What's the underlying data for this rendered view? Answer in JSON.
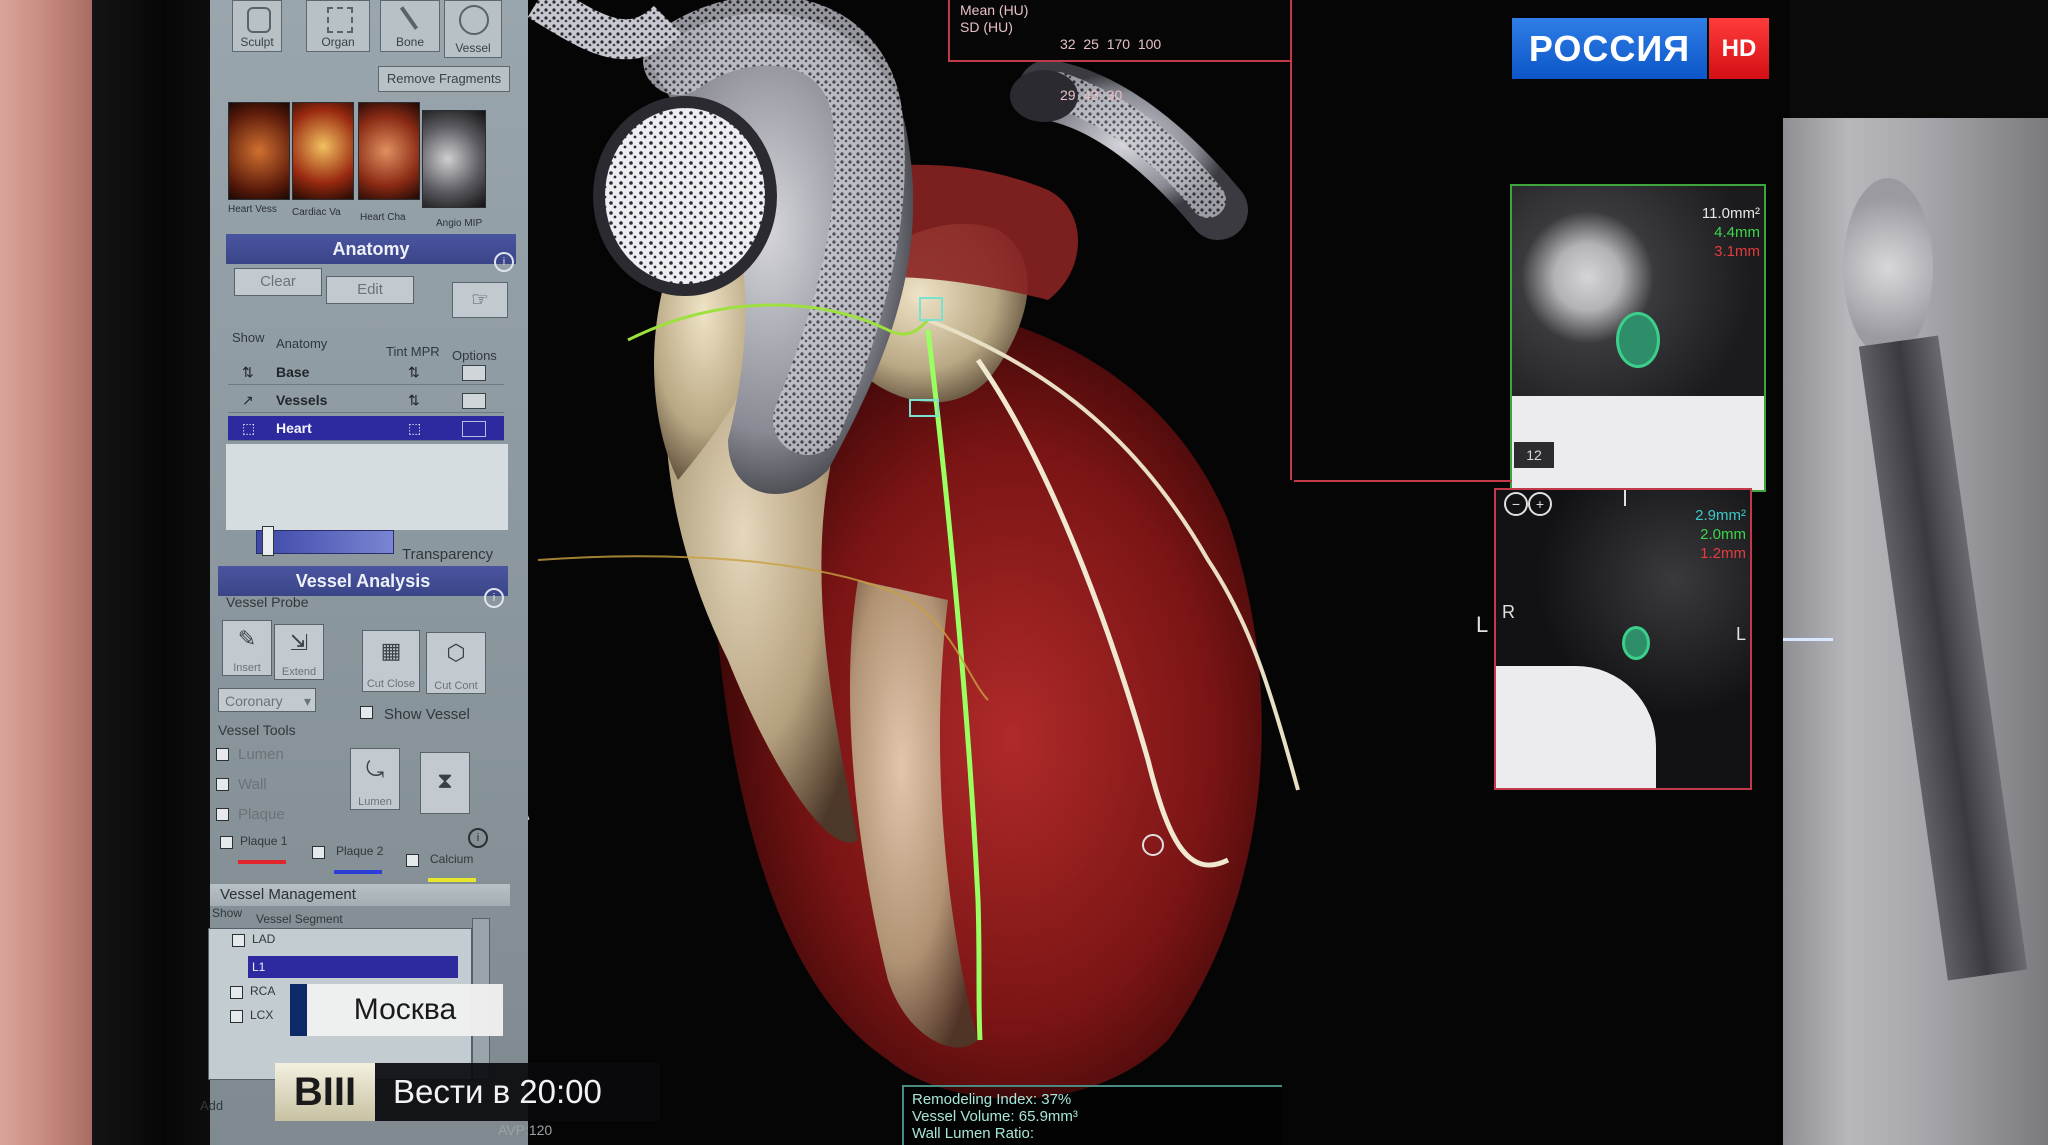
{
  "channel": {
    "name": "РОССИЯ",
    "hd": "HD"
  },
  "lower_third": {
    "city": "Москва",
    "program_logo": "ВIII",
    "program": "Вести в 20:00"
  },
  "toolbar": {
    "buttons": [
      "Sculpt",
      "Organ",
      "Bone",
      "Vessel"
    ],
    "remove_fragments": "Remove Fragments"
  },
  "thumbnails": [
    "Heart Vess",
    "Cardiac Va",
    "Heart Cha",
    "Angio MIP"
  ],
  "anatomy": {
    "title": "Anatomy",
    "clear": "Clear",
    "edit": "Edit",
    "columns": [
      "Show",
      "Anatomy",
      "Tint MPR",
      "Options"
    ],
    "rows": [
      "Base",
      "Vessels",
      "Heart"
    ],
    "transparency": "Transparency"
  },
  "vessel_analysis": {
    "title": "Vessel Analysis",
    "probe_label": "Vessel Probe",
    "probe_buttons": [
      "Insert",
      "Extend"
    ],
    "cut_buttons": [
      "Cut Close",
      "Cut Cont"
    ],
    "dropdown": "Coronary",
    "show_vessel": "Show Vessel",
    "tools_label": "Vessel Tools",
    "tools": [
      "Lumen",
      "Wall",
      "Plaque"
    ],
    "tool_buttons": [
      "Lumen"
    ],
    "plaques": [
      "Plaque 1",
      "Plaque 2",
      "Calcium"
    ],
    "plaque_colors": [
      "#e0262c",
      "#2b3fd8",
      "#e6e62a"
    ]
  },
  "vessel_management": {
    "title": "Vessel Management",
    "columns": [
      "Show",
      "Vessel Segment"
    ],
    "items": [
      "LAD",
      "L1",
      "RCA",
      "LCX"
    ],
    "add": "Add"
  },
  "viewer": {
    "orientation_r": "R",
    "stats_rows": [
      "Mean (HU)",
      "SD (HU)"
    ],
    "stats_values": [
      "32  25  170  100",
      "29  43  30"
    ],
    "mpr_top": {
      "measures": [
        "11.0mm²",
        "4.4mm",
        "3.1mm"
      ],
      "index": "12"
    },
    "mpr_bottom": {
      "measures": [
        "2.9mm²",
        "2.0mm",
        "1.2mm"
      ],
      "l_left": "L",
      "r_label": "R",
      "l_right": "L"
    },
    "remodeling": [
      "Remodeling Index: 37%",
      "Vessel Volume: 65.9mm³",
      "Wall Lumen Ratio:"
    ],
    "avp": "AVP:120"
  }
}
